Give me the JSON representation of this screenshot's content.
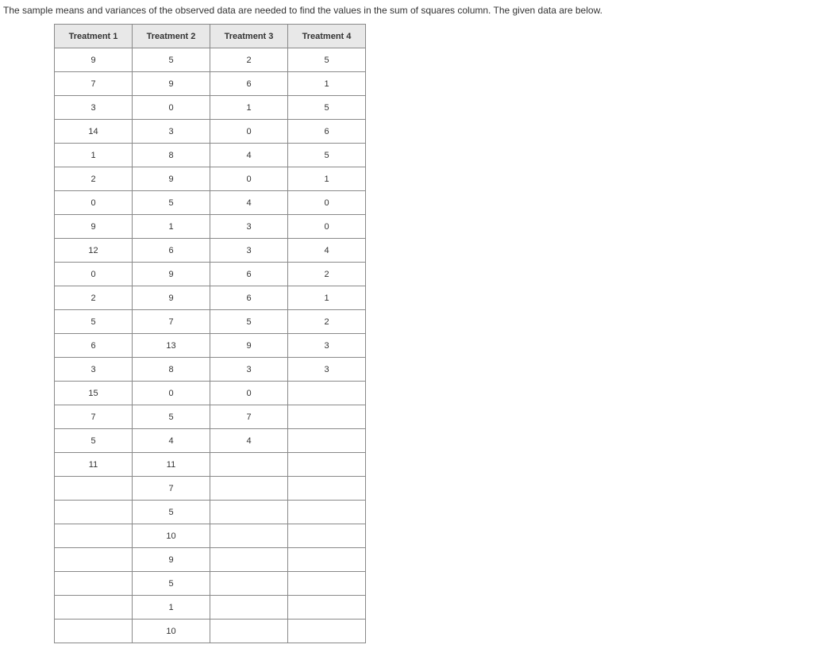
{
  "intro": "The sample means and variances of the observed data are needed to find the values in the sum of squares column. The given data are below.",
  "table": {
    "headers": [
      "Treatment 1",
      "Treatment 2",
      "Treatment 3",
      "Treatment 4"
    ],
    "rows": [
      [
        "9",
        "5",
        "2",
        "5"
      ],
      [
        "7",
        "9",
        "6",
        "1"
      ],
      [
        "3",
        "0",
        "1",
        "5"
      ],
      [
        "14",
        "3",
        "0",
        "6"
      ],
      [
        "1",
        "8",
        "4",
        "5"
      ],
      [
        "2",
        "9",
        "0",
        "1"
      ],
      [
        "0",
        "5",
        "4",
        "0"
      ],
      [
        "9",
        "1",
        "3",
        "0"
      ],
      [
        "12",
        "6",
        "3",
        "4"
      ],
      [
        "0",
        "9",
        "6",
        "2"
      ],
      [
        "2",
        "9",
        "6",
        "1"
      ],
      [
        "5",
        "7",
        "5",
        "2"
      ],
      [
        "6",
        "13",
        "9",
        "3"
      ],
      [
        "3",
        "8",
        "3",
        "3"
      ],
      [
        "15",
        "0",
        "0",
        ""
      ],
      [
        "7",
        "5",
        "7",
        ""
      ],
      [
        "5",
        "4",
        "4",
        ""
      ],
      [
        "11",
        "11",
        "",
        ""
      ],
      [
        "",
        "7",
        "",
        ""
      ],
      [
        "",
        "5",
        "",
        ""
      ],
      [
        "",
        "10",
        "",
        ""
      ],
      [
        "",
        "9",
        "",
        ""
      ],
      [
        "",
        "5",
        "",
        ""
      ],
      [
        "",
        "1",
        "",
        ""
      ],
      [
        "",
        "10",
        "",
        ""
      ]
    ]
  }
}
